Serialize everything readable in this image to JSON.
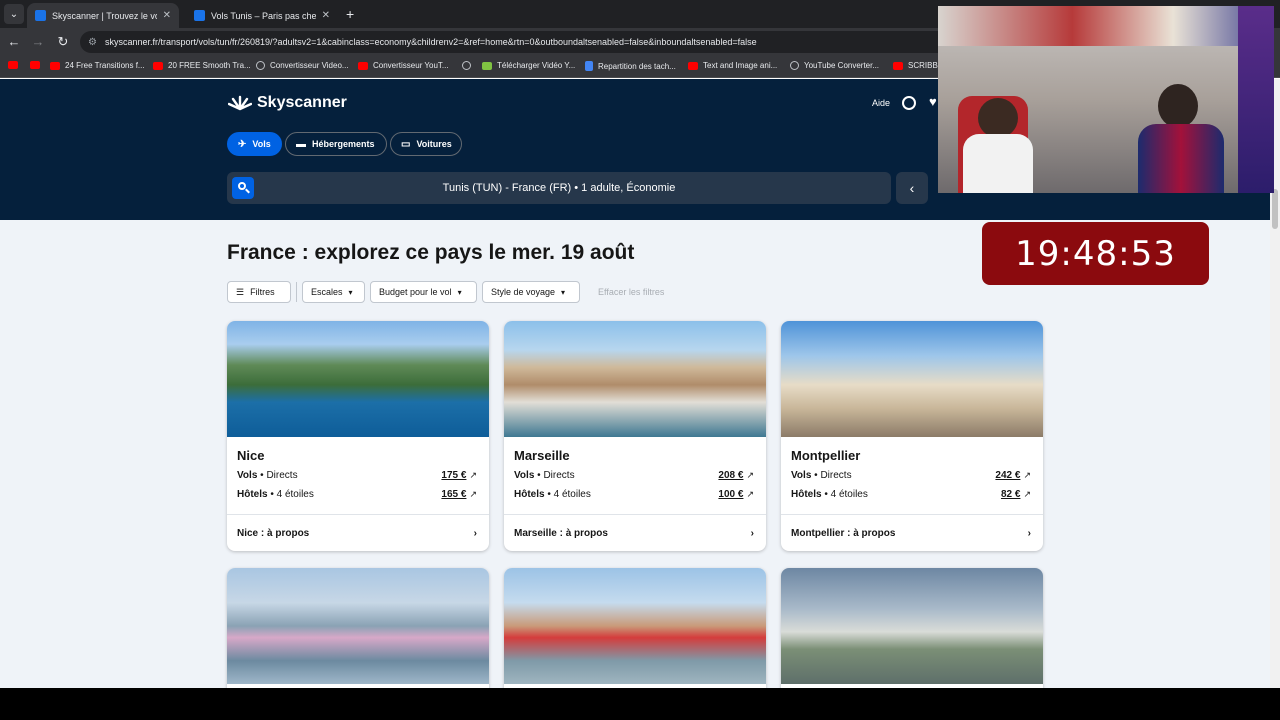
{
  "tabs": [
    {
      "title": "Skyscanner | Trouvez le vol pas",
      "active": true
    },
    {
      "title": "Vols Tunis – Paris pas chers sur",
      "active": false
    }
  ],
  "address": {
    "url": "skyscanner.fr/transport/vols/tun/fr/260819/?adultsv2=1&cabinclass=economy&childrenv2=&ref=home&rtn=0&outboundaltsenabled=false&inboundaltsenabled=false"
  },
  "bookmarks": [
    {
      "label": "",
      "icon": "youtube-icon"
    },
    {
      "label": "",
      "icon": "youtube-icon"
    },
    {
      "label": "24 Free Transitions f...",
      "icon": "youtube-icon"
    },
    {
      "label": "20 FREE Smooth Tra...",
      "icon": "youtube-icon"
    },
    {
      "label": "Convertisseur Video...",
      "icon": "globe-icon"
    },
    {
      "label": "Convertisseur YouT...",
      "icon": "youtube-icon"
    },
    {
      "label": "",
      "icon": "globe-icon"
    },
    {
      "label": "Télécharger Vidéo Y...",
      "icon": "download-icon"
    },
    {
      "label": "Repartition des tach...",
      "icon": "docs-icon"
    },
    {
      "label": "Text and Image ani...",
      "icon": "youtube-icon"
    },
    {
      "label": "YouTube Converter...",
      "icon": "globe-icon"
    },
    {
      "label": "SCRIBBL",
      "icon": "youtube-icon"
    }
  ],
  "header": {
    "brand": "Skyscanner",
    "help": "Aide",
    "nav": [
      "Vols",
      "Hébergements",
      "Voitures"
    ],
    "search_summary": "Tunis (TUN) - France (FR)  •  1 adulte, Économie"
  },
  "main": {
    "title": "France : explorez ce pays le mer. 19 août",
    "filters": {
      "filter_btn": "Filtres",
      "stops": "Escales",
      "budget": "Budget pour le vol",
      "style": "Style de voyage",
      "clear": "Effacer les filtres"
    },
    "cards": [
      {
        "city": "Nice",
        "flights_label": "Vols",
        "flights_type": "Directs",
        "flights_price": "175 €",
        "hotels_label": "Hôtels",
        "hotels_type": "4 étoiles",
        "hotels_price": "165 €",
        "about": "Nice : à propos"
      },
      {
        "city": "Marseille",
        "flights_label": "Vols",
        "flights_type": "Directs",
        "flights_price": "208 €",
        "hotels_label": "Hôtels",
        "hotels_type": "4 étoiles",
        "hotels_price": "100 €",
        "about": "Marseille : à propos"
      },
      {
        "city": "Montpellier",
        "flights_label": "Vols",
        "flights_type": "Directs",
        "flights_price": "242 €",
        "hotels_label": "Hôtels",
        "hotels_type": "4 étoiles",
        "hotels_price": "82 €",
        "about": "Montpellier : à propos"
      }
    ]
  },
  "overlay": {
    "clock": "19:48:53"
  },
  "colors": {
    "brand_dark": "#05203c",
    "accent": "#0062e3",
    "clock_bg": "#8b0a0e"
  }
}
